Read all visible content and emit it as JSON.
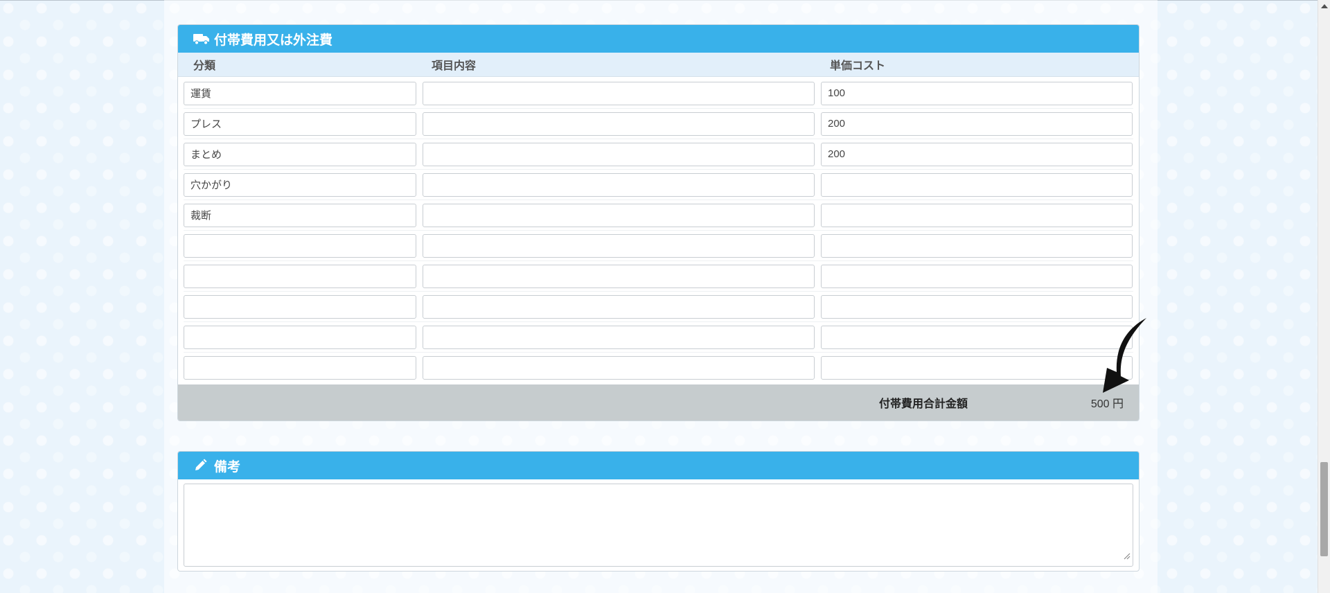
{
  "incidental_section": {
    "title": "付帯費用又は外注費",
    "icon": "truck-icon",
    "columns": [
      "分類",
      "項目内容",
      "単価コスト"
    ],
    "rows": [
      {
        "category": "運賃",
        "content": "",
        "unit_cost": "100"
      },
      {
        "category": "プレス",
        "content": "",
        "unit_cost": "200"
      },
      {
        "category": "まとめ",
        "content": "",
        "unit_cost": "200"
      },
      {
        "category": "穴かがり",
        "content": "",
        "unit_cost": ""
      },
      {
        "category": "裁断",
        "content": "",
        "unit_cost": ""
      },
      {
        "category": "",
        "content": "",
        "unit_cost": ""
      },
      {
        "category": "",
        "content": "",
        "unit_cost": ""
      },
      {
        "category": "",
        "content": "",
        "unit_cost": ""
      },
      {
        "category": "",
        "content": "",
        "unit_cost": ""
      },
      {
        "category": "",
        "content": "",
        "unit_cost": ""
      }
    ],
    "total_label": "付帯費用合計金額",
    "total_value": "500 円"
  },
  "remarks_section": {
    "title": "備考",
    "icon": "pencil-icon",
    "value": ""
  },
  "colors": {
    "header_blue": "#39b1ea",
    "column_header_bg": "#e2effa",
    "total_bar_bg": "#c6ccce"
  }
}
